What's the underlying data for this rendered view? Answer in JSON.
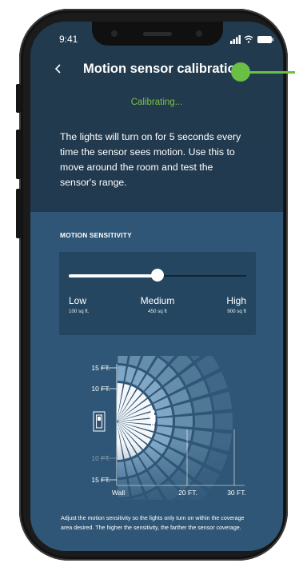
{
  "status_bar": {
    "time": "9:41"
  },
  "header": {
    "title": "Motion sensor calibration"
  },
  "status": {
    "text": "Calibrating..."
  },
  "description": "The lights will turn on for 5 seconds every time the sensor sees motion. Use this to move around the room and test the sensor's range.",
  "sensitivity": {
    "section_label": "MOTION SENSITIVITY",
    "value_fraction": 0.5,
    "levels": [
      {
        "name": "Low",
        "size": "100 sq ft."
      },
      {
        "name": "Medium",
        "size": "450 sq ft"
      },
      {
        "name": "High",
        "size": "900 sq ft"
      }
    ]
  },
  "coverage": {
    "y_labels": [
      "15 FT.",
      "10 FT.",
      "10 FT.",
      "15 FT."
    ],
    "x_labels": [
      "Wall",
      "20 FT.",
      "30 FT."
    ]
  },
  "footnote": "Adjust the motion sensitivity so the lights only turn on within the coverage area desired. The higher the sensitivity, the farther the sensor coverage.",
  "colors": {
    "accent_green": "#7bc043",
    "annotation_green": "#6abf45",
    "background_top": "#223a4f",
    "background_bottom": "#2f5676"
  }
}
